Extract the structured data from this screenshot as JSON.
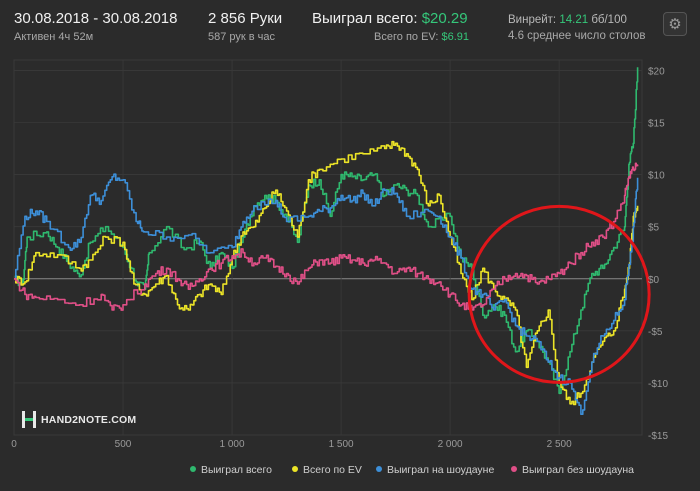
{
  "header": {
    "date_range": "30.08.2018 - 30.08.2018",
    "active": "Активен 4ч 52м",
    "hands": "2 856 Руки",
    "hands_rate": "587 рук в час",
    "won_label": "Выиграл всего:",
    "won_value": "$20.29",
    "ev_label": "Всего по EV:",
    "ev_value": "$6.91",
    "winrate_label": "Винрейт:",
    "winrate_value": "14.21",
    "winrate_unit": "бб/100",
    "tables": "4.6 среднее число столов",
    "settings_icon": "gear-icon"
  },
  "logo": {
    "text": "HAND2NOTE.COM",
    "icon": "h2n-logo-icon"
  },
  "chart_data": {
    "type": "line",
    "xlim": [
      0,
      2880
    ],
    "ylim": [
      -15,
      21
    ],
    "x_ticks": [
      0,
      500,
      1000,
      1500,
      2000,
      2500
    ],
    "x_tick_labels": [
      "0",
      "500",
      "1 000",
      "1 500",
      "2 000",
      "2 500"
    ],
    "y_ticks": [
      20,
      15,
      10,
      5,
      0,
      -5,
      -10,
      -15
    ],
    "y_tick_labels": [
      "$20",
      "$15",
      "$10",
      "$5",
      "$0",
      "-$5",
      "-$10",
      "-$15"
    ],
    "grid": true,
    "legend_position": "bottom",
    "series": [
      {
        "name": "Выиграл всего",
        "color": "#2fb86e",
        "points": [
          [
            0,
            0
          ],
          [
            40,
            -0.5
          ],
          [
            60,
            4
          ],
          [
            150,
            4.5
          ],
          [
            200,
            3
          ],
          [
            250,
            1.5
          ],
          [
            300,
            0.2
          ],
          [
            350,
            3.5
          ],
          [
            420,
            5
          ],
          [
            500,
            3
          ],
          [
            560,
            -0.3
          ],
          [
            600,
            -1
          ],
          [
            620,
            2.5
          ],
          [
            700,
            5
          ],
          [
            780,
            2.8
          ],
          [
            850,
            3.6
          ],
          [
            900,
            1
          ],
          [
            950,
            2.5
          ],
          [
            1000,
            1
          ],
          [
            1050,
            4
          ],
          [
            1100,
            7
          ],
          [
            1150,
            8
          ],
          [
            1200,
            7.5
          ],
          [
            1250,
            6
          ],
          [
            1300,
            3.5
          ],
          [
            1350,
            9
          ],
          [
            1400,
            9.5
          ],
          [
            1450,
            6
          ],
          [
            1500,
            10
          ],
          [
            1550,
            9.8
          ],
          [
            1600,
            9.5
          ],
          [
            1650,
            10
          ],
          [
            1700,
            8
          ],
          [
            1750,
            9
          ],
          [
            1800,
            8.5
          ],
          [
            1850,
            8
          ],
          [
            1900,
            5
          ],
          [
            2000,
            6
          ],
          [
            2050,
            2
          ],
          [
            2100,
            1
          ],
          [
            2150,
            -3.5
          ],
          [
            2200,
            -2.5
          ],
          [
            2250,
            -3.5
          ],
          [
            2300,
            -7
          ],
          [
            2350,
            -5
          ],
          [
            2400,
            -6
          ],
          [
            2450,
            -8
          ],
          [
            2500,
            -11
          ],
          [
            2550,
            -7
          ],
          [
            2600,
            -3
          ],
          [
            2650,
            0.5
          ],
          [
            2700,
            1
          ],
          [
            2750,
            3
          ],
          [
            2800,
            5
          ],
          [
            2820,
            11
          ],
          [
            2840,
            13
          ],
          [
            2860,
            20.3
          ]
        ]
      },
      {
        "name": "Всего по EV",
        "color": "#ece427",
        "points": [
          [
            0,
            0
          ],
          [
            50,
            -0.3
          ],
          [
            100,
            2.5
          ],
          [
            200,
            2.3
          ],
          [
            300,
            1
          ],
          [
            350,
            1.8
          ],
          [
            420,
            4
          ],
          [
            500,
            3.5
          ],
          [
            550,
            -0.5
          ],
          [
            600,
            -1.5
          ],
          [
            650,
            -0.5
          ],
          [
            700,
            0.3
          ],
          [
            750,
            -2.5
          ],
          [
            800,
            -3
          ],
          [
            850,
            -1.5
          ],
          [
            900,
            -0.5
          ],
          [
            950,
            -1.5
          ],
          [
            1000,
            2
          ],
          [
            1050,
            4.5
          ],
          [
            1100,
            5
          ],
          [
            1150,
            6.8
          ],
          [
            1200,
            8.5
          ],
          [
            1250,
            6.5
          ],
          [
            1300,
            4
          ],
          [
            1350,
            9.5
          ],
          [
            1400,
            10.5
          ],
          [
            1500,
            11.5
          ],
          [
            1600,
            12
          ],
          [
            1700,
            12.5
          ],
          [
            1750,
            13
          ],
          [
            1800,
            12
          ],
          [
            1850,
            10.5
          ],
          [
            1900,
            7
          ],
          [
            1950,
            8
          ],
          [
            2000,
            4
          ],
          [
            2050,
            0.5
          ],
          [
            2100,
            -2
          ],
          [
            2150,
            1
          ],
          [
            2200,
            -1
          ],
          [
            2250,
            -2
          ],
          [
            2300,
            -3
          ],
          [
            2350,
            -8.5
          ],
          [
            2400,
            -5
          ],
          [
            2450,
            -3
          ],
          [
            2500,
            -10
          ],
          [
            2550,
            -12
          ],
          [
            2600,
            -11
          ],
          [
            2650,
            -8
          ],
          [
            2700,
            -6
          ],
          [
            2750,
            -5
          ],
          [
            2800,
            -1
          ],
          [
            2820,
            1
          ],
          [
            2840,
            6
          ],
          [
            2860,
            7
          ]
        ]
      },
      {
        "name": "Выиграл на шоудауне",
        "color": "#3d8fd8",
        "points": [
          [
            0,
            0
          ],
          [
            50,
            6
          ],
          [
            100,
            6.5
          ],
          [
            150,
            5.5
          ],
          [
            250,
            3
          ],
          [
            300,
            3.5
          ],
          [
            350,
            8
          ],
          [
            400,
            7.5
          ],
          [
            450,
            9.8
          ],
          [
            500,
            9.5
          ],
          [
            560,
            5.5
          ],
          [
            600,
            4.5
          ],
          [
            700,
            4
          ],
          [
            800,
            4.2
          ],
          [
            900,
            2.5
          ],
          [
            1000,
            3
          ],
          [
            1050,
            5.5
          ],
          [
            1100,
            7
          ],
          [
            1200,
            7.5
          ],
          [
            1250,
            5.5
          ],
          [
            1350,
            6
          ],
          [
            1400,
            6.5
          ],
          [
            1450,
            6.8
          ],
          [
            1500,
            8
          ],
          [
            1550,
            7.5
          ],
          [
            1600,
            8.2
          ],
          [
            1650,
            7
          ],
          [
            1700,
            8.5
          ],
          [
            1750,
            8.2
          ],
          [
            1800,
            6
          ],
          [
            1900,
            6.5
          ],
          [
            1950,
            6
          ],
          [
            2000,
            4
          ],
          [
            2050,
            2
          ],
          [
            2100,
            -1
          ],
          [
            2150,
            -1.5
          ],
          [
            2200,
            -3
          ],
          [
            2250,
            -2
          ],
          [
            2300,
            -4.5
          ],
          [
            2350,
            -5.5
          ],
          [
            2400,
            -6
          ],
          [
            2450,
            -8
          ],
          [
            2500,
            -9.5
          ],
          [
            2550,
            -10
          ],
          [
            2600,
            -13
          ],
          [
            2650,
            -8
          ],
          [
            2700,
            -5.5
          ],
          [
            2750,
            -4
          ],
          [
            2800,
            -2
          ],
          [
            2840,
            5
          ],
          [
            2860,
            9.7
          ]
        ]
      },
      {
        "name": "Выиграл без шоудауна",
        "color": "#e04f87",
        "points": [
          [
            0,
            0
          ],
          [
            50,
            -1.5
          ],
          [
            100,
            -1.8
          ],
          [
            200,
            -2
          ],
          [
            300,
            -2.5
          ],
          [
            400,
            -1.5
          ],
          [
            450,
            -3
          ],
          [
            500,
            -2.5
          ],
          [
            600,
            -0.5
          ],
          [
            650,
            0.5
          ],
          [
            700,
            1
          ],
          [
            750,
            0
          ],
          [
            800,
            -1
          ],
          [
            850,
            0
          ],
          [
            900,
            1
          ],
          [
            950,
            1.5
          ],
          [
            1000,
            2.2
          ],
          [
            1050,
            2.5
          ],
          [
            1100,
            1.5
          ],
          [
            1150,
            2
          ],
          [
            1200,
            1.2
          ],
          [
            1250,
            0.5
          ],
          [
            1300,
            -0.5
          ],
          [
            1350,
            1
          ],
          [
            1400,
            1.8
          ],
          [
            1450,
            1.5
          ],
          [
            1500,
            2
          ],
          [
            1550,
            1.8
          ],
          [
            1600,
            1.5
          ],
          [
            1650,
            1.8
          ],
          [
            1700,
            1.5
          ],
          [
            1750,
            0.5
          ],
          [
            1800,
            1
          ],
          [
            1850,
            0.5
          ],
          [
            1900,
            0
          ],
          [
            1950,
            -0.3
          ],
          [
            2000,
            -1.5
          ],
          [
            2050,
            -2.5
          ],
          [
            2100,
            -3
          ],
          [
            2150,
            -2.5
          ],
          [
            2200,
            -1
          ],
          [
            2250,
            0
          ],
          [
            2300,
            0.5
          ],
          [
            2350,
            0.3
          ],
          [
            2400,
            -0.5
          ],
          [
            2450,
            0
          ],
          [
            2500,
            0.5
          ],
          [
            2550,
            1.5
          ],
          [
            2600,
            2.5
          ],
          [
            2650,
            3.5
          ],
          [
            2700,
            4
          ],
          [
            2750,
            5.5
          ],
          [
            2800,
            8
          ],
          [
            2820,
            9.8
          ],
          [
            2840,
            10.5
          ],
          [
            2860,
            10.8
          ]
        ]
      }
    ]
  },
  "annotation": {
    "shape": "ellipse",
    "color": "#e0161a"
  }
}
